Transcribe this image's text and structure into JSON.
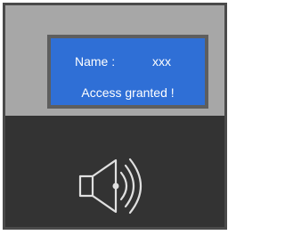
{
  "display": {
    "name_label": "Name :",
    "name_value": "xxx",
    "status_message": "Access granted !"
  },
  "colors": {
    "screen_background": "#2f6fd6",
    "panel_upper": "#a7a7a7",
    "panel_lower": "#333333",
    "icon_stroke": "#e0e0e0"
  },
  "icons": {
    "speaker": "speaker-sound-icon"
  }
}
